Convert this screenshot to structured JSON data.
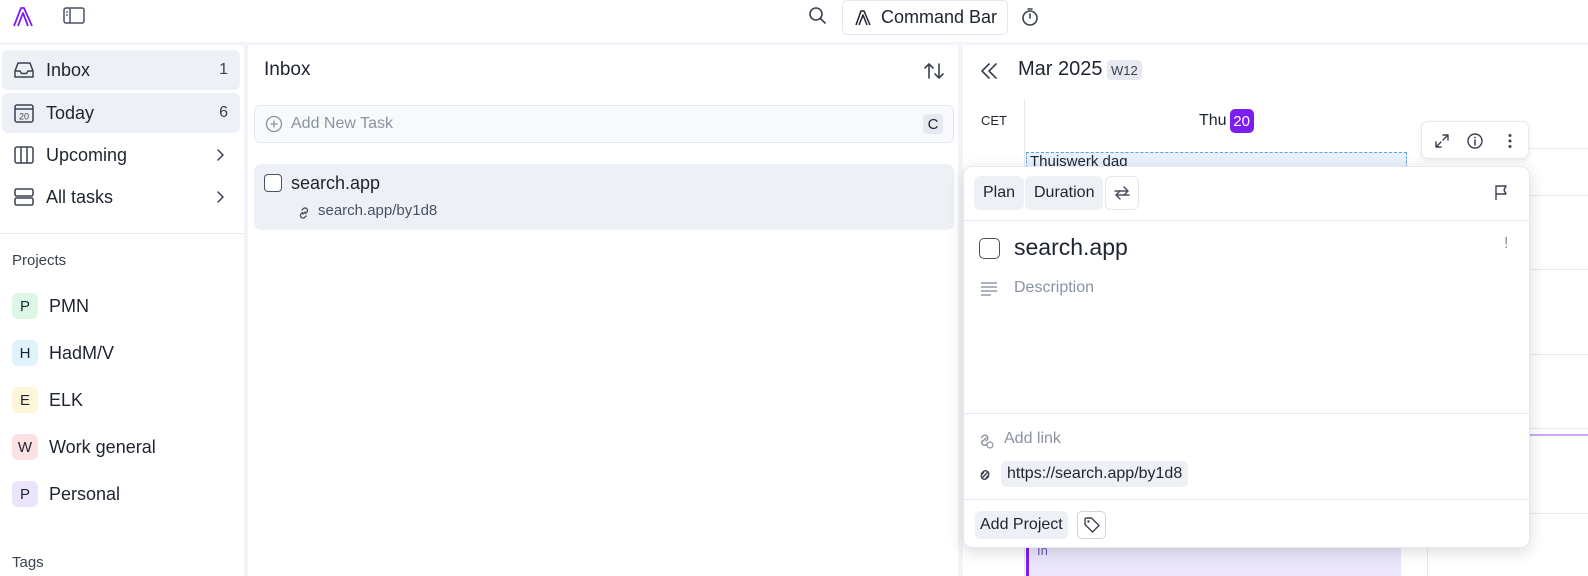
{
  "topbar": {
    "command_bar_label": "Command Bar"
  },
  "sidebar": {
    "nav": [
      {
        "label": "Inbox",
        "count": "1"
      },
      {
        "label": "Today",
        "count": "6",
        "icon_text": "20"
      },
      {
        "label": "Upcoming"
      },
      {
        "label": "All tasks"
      }
    ],
    "projects_heading": "Projects",
    "projects": [
      {
        "letter": "P",
        "name": "PMN",
        "color": "#dcf7e6"
      },
      {
        "letter": "H",
        "name": "HadM/V",
        "color": "#dff3fb"
      },
      {
        "letter": "E",
        "name": "ELK",
        "color": "#fdf6d9"
      },
      {
        "letter": "W",
        "name": "Work general",
        "color": "#fce1e3"
      },
      {
        "letter": "P",
        "name": "Personal",
        "color": "#ece4fb"
      }
    ],
    "tags_heading": "Tags"
  },
  "inbox": {
    "title": "Inbox",
    "add_task_placeholder": "Add New Task",
    "add_task_shortcut": "C",
    "task": {
      "title": "search.app",
      "link": "search.app/by1d8"
    }
  },
  "calendar": {
    "month": "Mar 2025",
    "week": "W12",
    "timezone": "CET",
    "day_name": "Thu",
    "day_number": "20",
    "event_title": "Thuiswerk dag",
    "event_bottom_text": "In",
    "accent": "#7c1df2"
  },
  "detail": {
    "plan_label": "Plan",
    "duration_label": "Duration",
    "title": "search.app",
    "priority": "!",
    "description_placeholder": "Description",
    "add_link_label": "Add link",
    "link": "https://search.app/by1d8",
    "add_project_label": "Add Project"
  }
}
